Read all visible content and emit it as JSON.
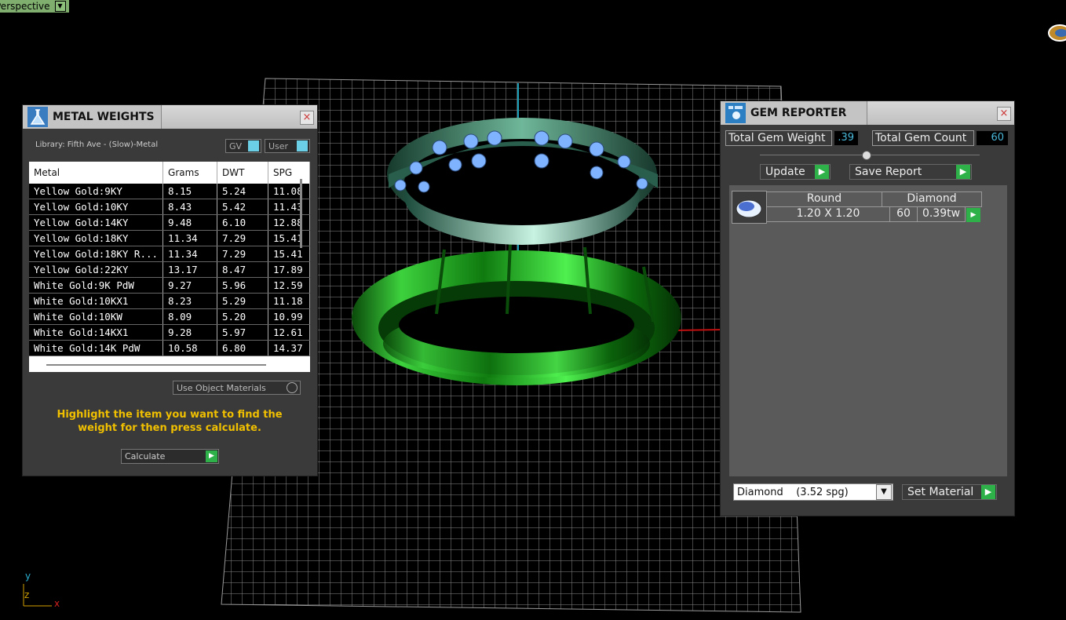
{
  "viewport": {
    "label": "Perspective",
    "dropdown_glyph": "▼"
  },
  "axis_gizmo": {
    "y": "y",
    "z": "z",
    "x": "x"
  },
  "metal_weights": {
    "title": "METAL WEIGHTS",
    "close": "×",
    "library_label": "Library: Fifth Ave - (Slow)-Metal",
    "gv_label": "GV",
    "user_label": "User",
    "columns": [
      "Metal",
      "Grams",
      "DWT",
      "SPG"
    ],
    "rows": [
      [
        "Yellow Gold:9KY",
        "8.15",
        "5.24",
        "11.08"
      ],
      [
        "Yellow Gold:10KY",
        "8.43",
        "5.42",
        "11.43"
      ],
      [
        "Yellow Gold:14KY",
        "9.48",
        "6.10",
        "12.88"
      ],
      [
        "Yellow Gold:18KY",
        "11.34",
        "7.29",
        "15.41"
      ],
      [
        "Yellow Gold:18KY R...",
        "11.34",
        "7.29",
        "15.41"
      ],
      [
        "Yellow Gold:22KY",
        "13.17",
        "8.47",
        "17.89"
      ],
      [
        "White Gold:9K PdW",
        "9.27",
        "5.96",
        "12.59"
      ],
      [
        "White Gold:10KX1",
        "8.23",
        "5.29",
        "11.18"
      ],
      [
        "White Gold:10KW",
        "8.09",
        "5.20",
        "10.99"
      ],
      [
        "White Gold:14KX1",
        "9.28",
        "5.97",
        "12.61"
      ],
      [
        "White Gold:14K PdW",
        "10.58",
        "6.80",
        "14.37"
      ]
    ],
    "use_object_materials": "Use Object Materials",
    "hint": "Highlight the item you want to find the weight for then press calculate.",
    "calculate": "Calculate",
    "go_glyph": "▶"
  },
  "gem_reporter": {
    "title": "GEM REPORTER",
    "close": "×",
    "total_weight_label": "Total Gem Weight",
    "total_weight_value": ".39",
    "total_count_label": "Total Gem Count",
    "total_count_value": "60",
    "update": "Update",
    "save_report": "Save Report",
    "gem": {
      "shape": "Round",
      "material": "Diamond",
      "size": "1.20 X 1.20",
      "count": "60",
      "weight": "0.39tw"
    },
    "material_select": "Diamond    (3.52 spg)",
    "set_material": "Set Material",
    "go_glyph": "▶"
  },
  "colors": {
    "accent_go": "#2fb14a",
    "value_blue": "#49b8d9",
    "hint_yellow": "#f0c000",
    "viewport_green": "#7fae6e"
  }
}
